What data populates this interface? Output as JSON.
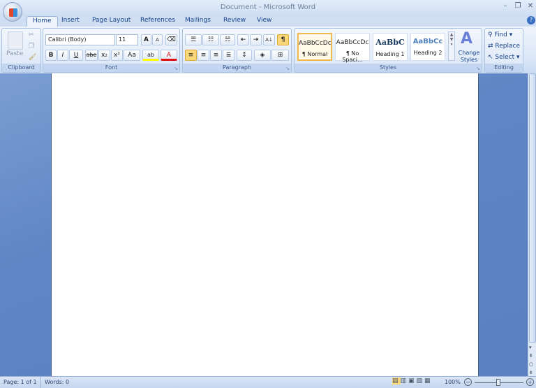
{
  "window": {
    "title": "Document  - Microsoft Word",
    "minimize": "–",
    "restore": "❐",
    "close": "✕",
    "help": "?"
  },
  "tabs": [
    {
      "label": "Home",
      "active": true
    },
    {
      "label": "Insert"
    },
    {
      "label": "Page Layout"
    },
    {
      "label": "References"
    },
    {
      "label": "Mailings"
    },
    {
      "label": "Review"
    },
    {
      "label": "View"
    }
  ],
  "clipboard": {
    "label": "Clipboard",
    "paste": "Paste"
  },
  "font": {
    "label": "Font",
    "name": "Calibri (Body)",
    "size": "11",
    "bold": "B",
    "italic": "I",
    "underline": "U",
    "strike": "abe",
    "subscript": "x₂",
    "superscript": "x²",
    "case": "Aa",
    "grow": "A",
    "shrink": "A",
    "highlight": "ab",
    "color": "A",
    "highlight_color": "#ffff00",
    "font_color": "#e01010"
  },
  "paragraph": {
    "label": "Paragraph",
    "pilcrow": "¶",
    "sort": "A↓"
  },
  "styles": {
    "label": "Styles",
    "items": [
      {
        "preview": "AaBbCcDc",
        "name": "¶ Normal",
        "selected": true
      },
      {
        "preview": "AaBbCcDc",
        "name": "¶ No Spaci..."
      },
      {
        "preview": "AaBbC",
        "name": "Heading 1"
      },
      {
        "preview": "AaBbCc",
        "name": "Heading 2"
      }
    ],
    "change": "Change Styles"
  },
  "editing": {
    "label": "Editing",
    "find": "Find",
    "replace": "Replace",
    "select": "Select"
  },
  "status": {
    "page": "Page: 1 of 1",
    "words": "Words: 0",
    "zoom": "100%",
    "zoom_percent": 100
  }
}
